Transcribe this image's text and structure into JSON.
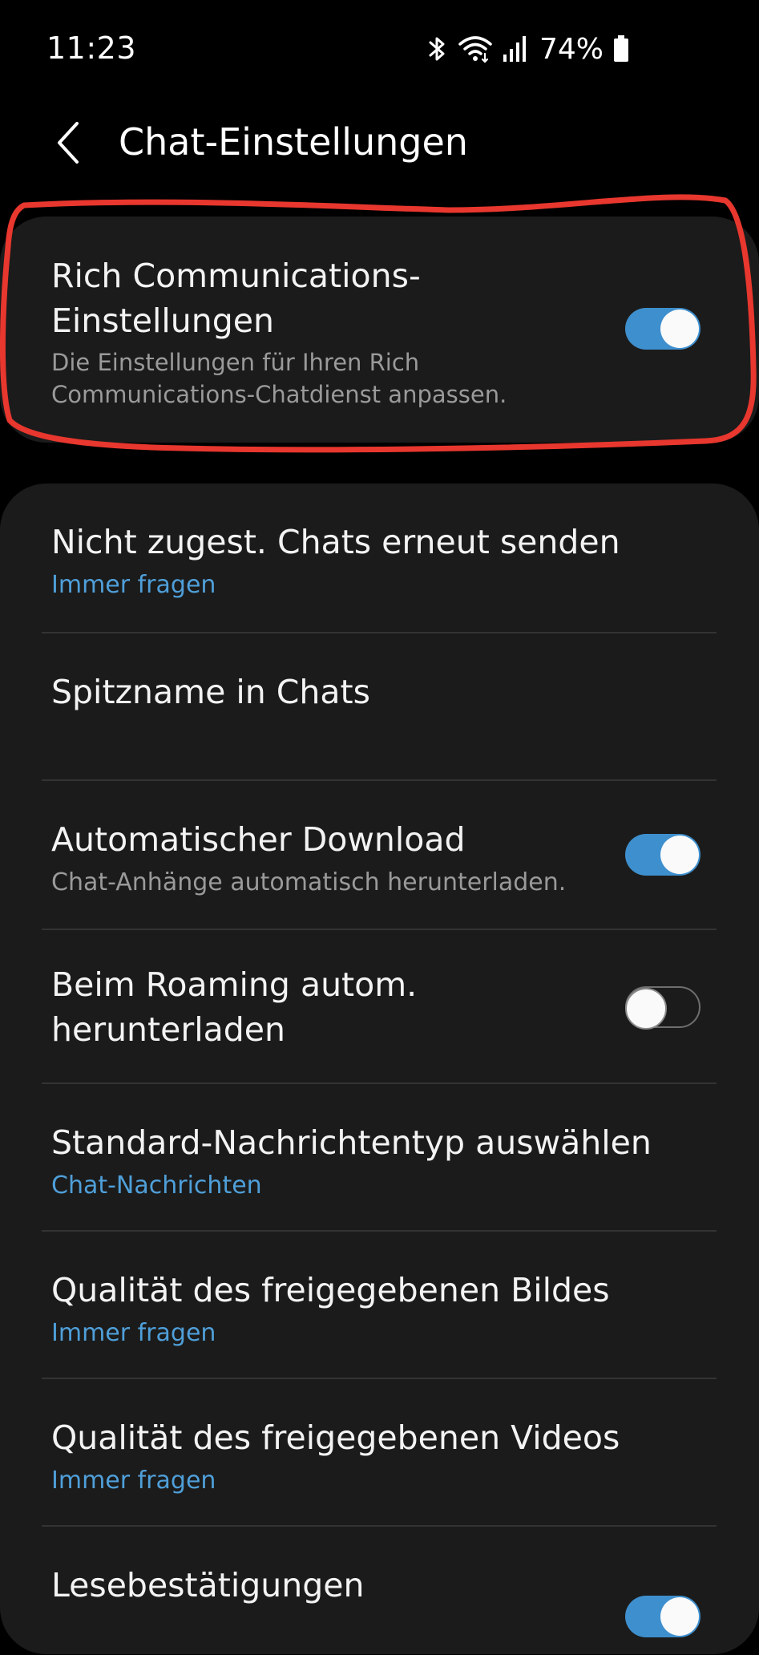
{
  "status_bar": {
    "time": "11:23",
    "battery": "74%",
    "icons": [
      "bluetooth-icon",
      "wifi-icon",
      "signal-icon",
      "battery-icon"
    ]
  },
  "header": {
    "back_icon": "chevron-left-icon",
    "title": "Chat-Einstellungen"
  },
  "rcs": {
    "title": "Rich Communications-Einstellungen",
    "description": "Die Einstellungen für Ihren Rich Communications-Chatdienst anpassen.",
    "enabled": true
  },
  "settings": [
    {
      "title": "Nicht zugest. Chats erneut senden",
      "subtitle": "Immer fragen"
    },
    {
      "title": "Spitzname in Chats",
      "subtitle": ""
    },
    {
      "title": "Automatischer Download",
      "subtitle": "Chat-Anhänge automatisch herunterladen.",
      "toggle": true
    },
    {
      "title": "Beim Roaming autom. herunterladen",
      "toggle": false
    },
    {
      "title": "Standard-Nachrichtentyp auswählen",
      "subtitle": "Chat-Nachrichten"
    },
    {
      "title": "Qualität des freigegebenen Bildes",
      "subtitle": "Immer fragen"
    },
    {
      "title": "Qualität des freigegebenen Videos",
      "subtitle": "Immer fragen"
    },
    {
      "title": "Lesebestätigungen",
      "toggle": true
    }
  ],
  "colors": {
    "accent": "#3e8fce",
    "link": "#4f9fd9",
    "annotation": "#e8372e",
    "card": "#1b1b1b"
  }
}
